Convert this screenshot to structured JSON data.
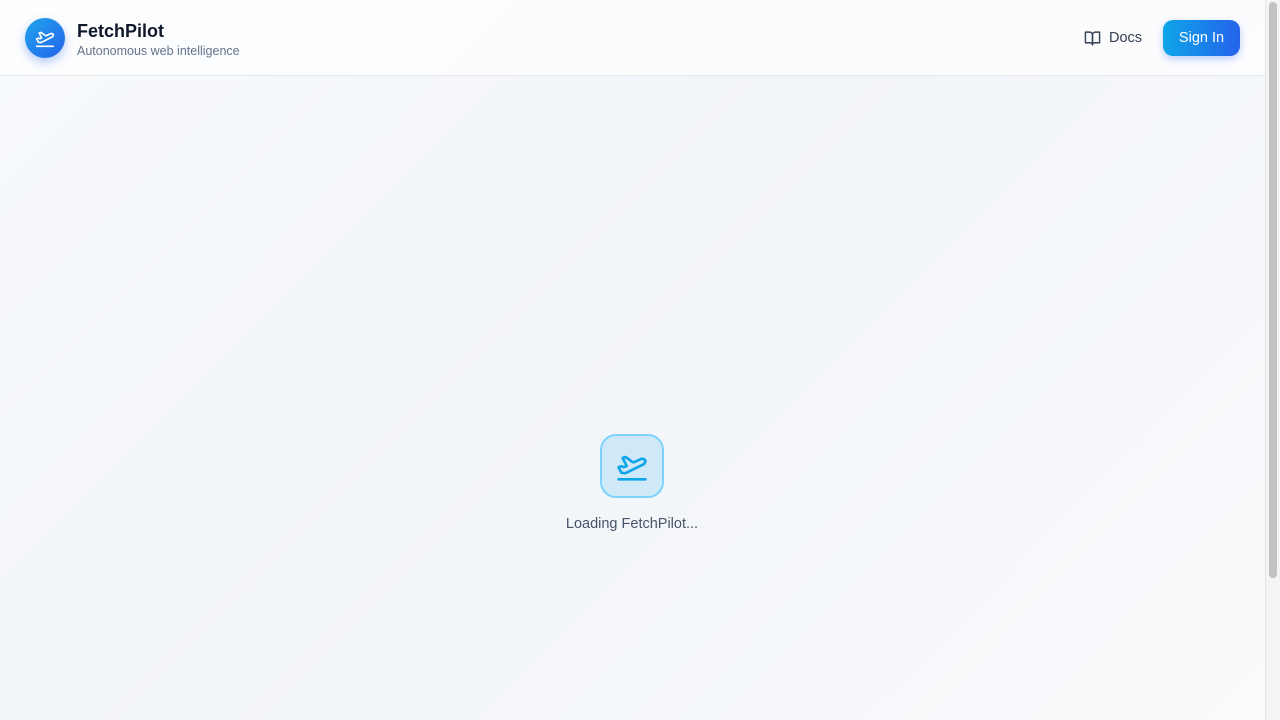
{
  "header": {
    "brand_name": "FetchPilot",
    "brand_tagline": "Autonomous web intelligence",
    "logo_icon": "plane-takeoff-icon",
    "docs_label": "Docs",
    "docs_icon": "book-open-icon",
    "signin_label": "Sign In"
  },
  "main": {
    "loader_icon": "plane-takeoff-icon",
    "loading_text": "Loading FetchPilot..."
  },
  "colors": {
    "accent_start": "#0ea5e9",
    "accent_end": "#2563eb",
    "text_primary": "#0f172a",
    "text_muted": "#64748b"
  }
}
